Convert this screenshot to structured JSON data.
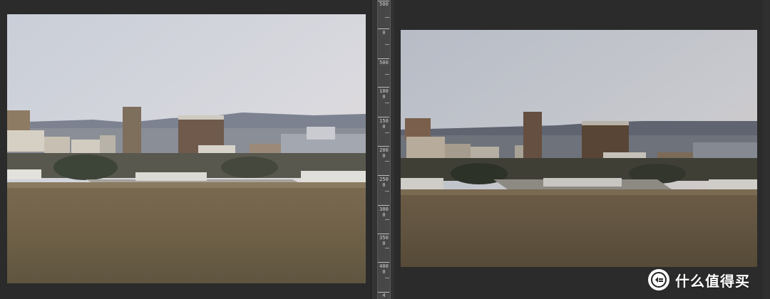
{
  "ruler": {
    "labels": [
      "500",
      "0",
      "500",
      "1000",
      "1500",
      "2000",
      "2500",
      "3000",
      "3500",
      "4000",
      "4"
    ]
  },
  "photos": {
    "left_icon": "landscape-photo-icon",
    "right_icon": "landscape-photo-icon"
  },
  "watermark": {
    "text": "什么值得买",
    "icon": "smzdm-logo-icon"
  },
  "colors": {
    "window_bg": "#262626",
    "panel_bg": "#2b2b2b",
    "ruler_bg": "#474747",
    "ruler_text": "#d0d0d0"
  }
}
